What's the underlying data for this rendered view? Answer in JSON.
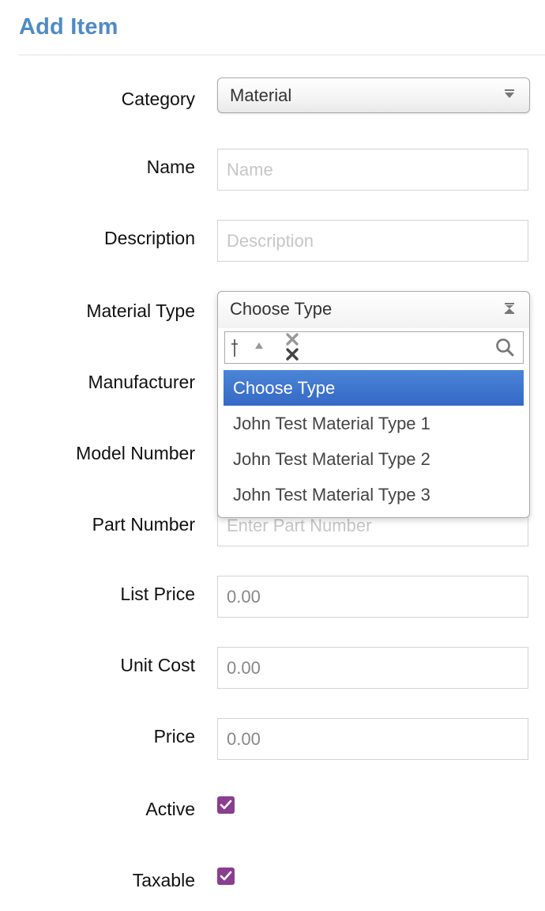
{
  "header": {
    "title": "Add Item"
  },
  "form": {
    "category": {
      "label": "Category",
      "value": "Material"
    },
    "name": {
      "label": "Name",
      "placeholder": "Name"
    },
    "description": {
      "label": "Description",
      "placeholder": "Description"
    },
    "material_type": {
      "label": "Material Type",
      "value": "Choose Type",
      "options": [
        "Choose Type",
        "John Test Material Type 1",
        "John Test Material Type 2",
        "John Test Material Type 3"
      ],
      "highlighted_index": 0
    },
    "manufacturer": {
      "label": "Manufacturer"
    },
    "model_number": {
      "label": "Model Number"
    },
    "part_number": {
      "label": "Part Number",
      "placeholder": "Enter Part Number"
    },
    "list_price": {
      "label": "List Price",
      "value": "0.00"
    },
    "unit_cost": {
      "label": "Unit Cost",
      "value": "0.00"
    },
    "price": {
      "label": "Price",
      "value": "0.00"
    },
    "active": {
      "label": "Active",
      "checked": true
    },
    "taxable": {
      "label": "Taxable",
      "checked": true
    }
  },
  "colors": {
    "title": "#4f8bc4",
    "highlight": "#3d74cf",
    "checkbox": "#8a3e8f"
  },
  "icons": {
    "select_caret": "chevron-down-icon",
    "search": "search-icon",
    "clear": "clear-icon",
    "checkmark": "checkmark-icon"
  }
}
